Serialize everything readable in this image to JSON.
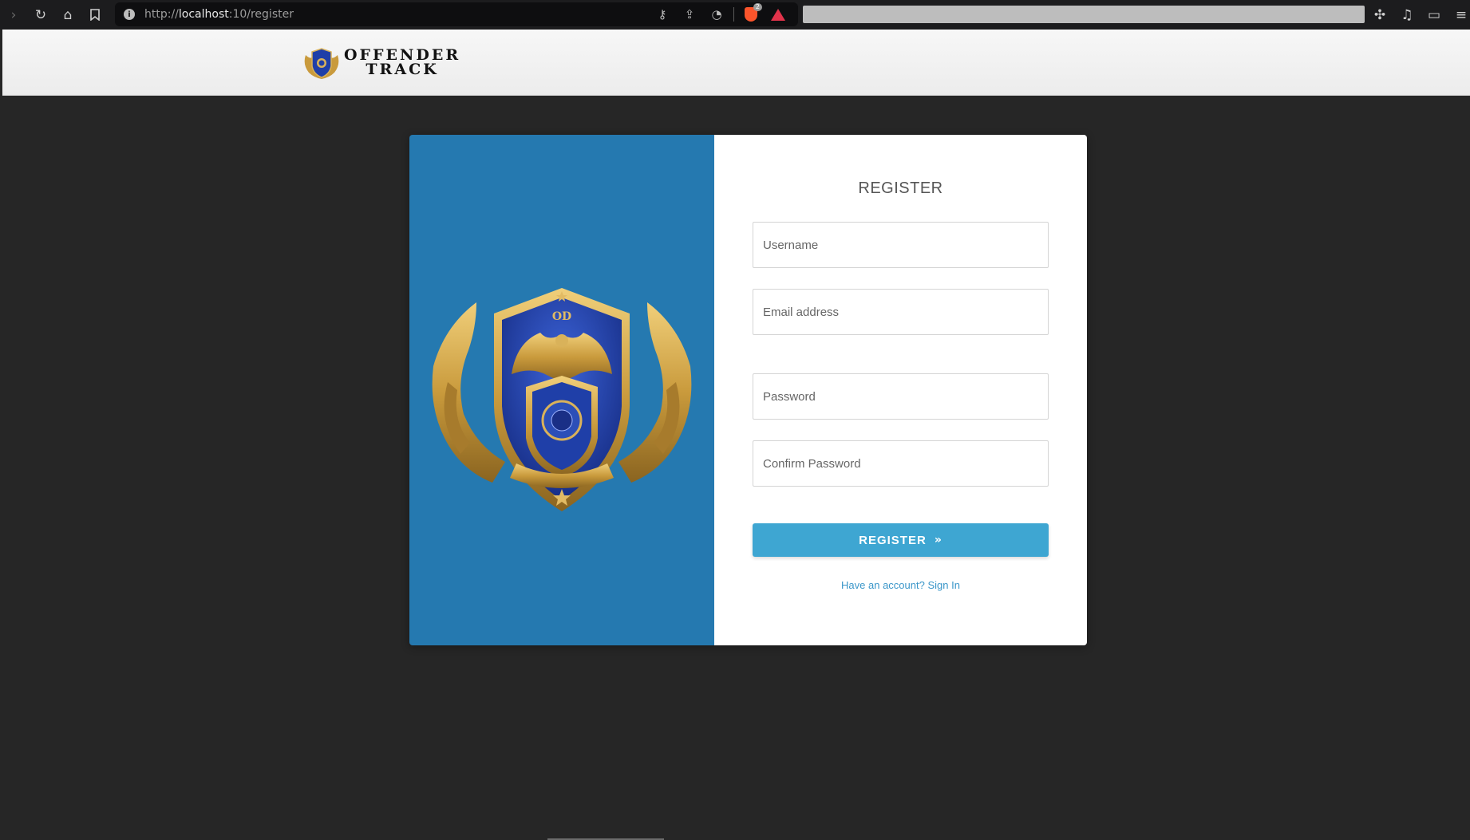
{
  "browser": {
    "url_scheme": "http://",
    "url_host": "localhost",
    "url_path": ":10/register",
    "brave_badge_count": "2",
    "icons": {
      "forward": "chevron-right-icon",
      "reload": "reload-icon",
      "home": "home-icon",
      "bookmark": "bookmark-icon",
      "info": "info-icon",
      "key": "key-icon",
      "share": "share-icon",
      "rss": "rss-icon",
      "brave": "brave-shield-icon",
      "rewards": "brave-rewards-icon",
      "extensions": "puzzle-icon",
      "media": "music-note-icon",
      "wallet": "wallet-icon"
    }
  },
  "header": {
    "brand_line1": "OFFENDER",
    "brand_line2": "TRACK"
  },
  "form": {
    "title": "REGISTER",
    "username_placeholder": "Username",
    "email_placeholder": "Email address",
    "password_placeholder": "Password",
    "confirm_password_placeholder": "Confirm Password",
    "submit_label": "REGISTER",
    "signin_link": "Have an account? Sign In"
  },
  "emblem": {
    "top_text": "OD"
  },
  "colors": {
    "page_bg": "#262626",
    "panel_blue": "#2579b0",
    "button_blue": "#3ea6d2",
    "link_blue": "#3a96c9",
    "emblem_gold": "#c99a3c",
    "emblem_blue": "#1f3fa8"
  }
}
